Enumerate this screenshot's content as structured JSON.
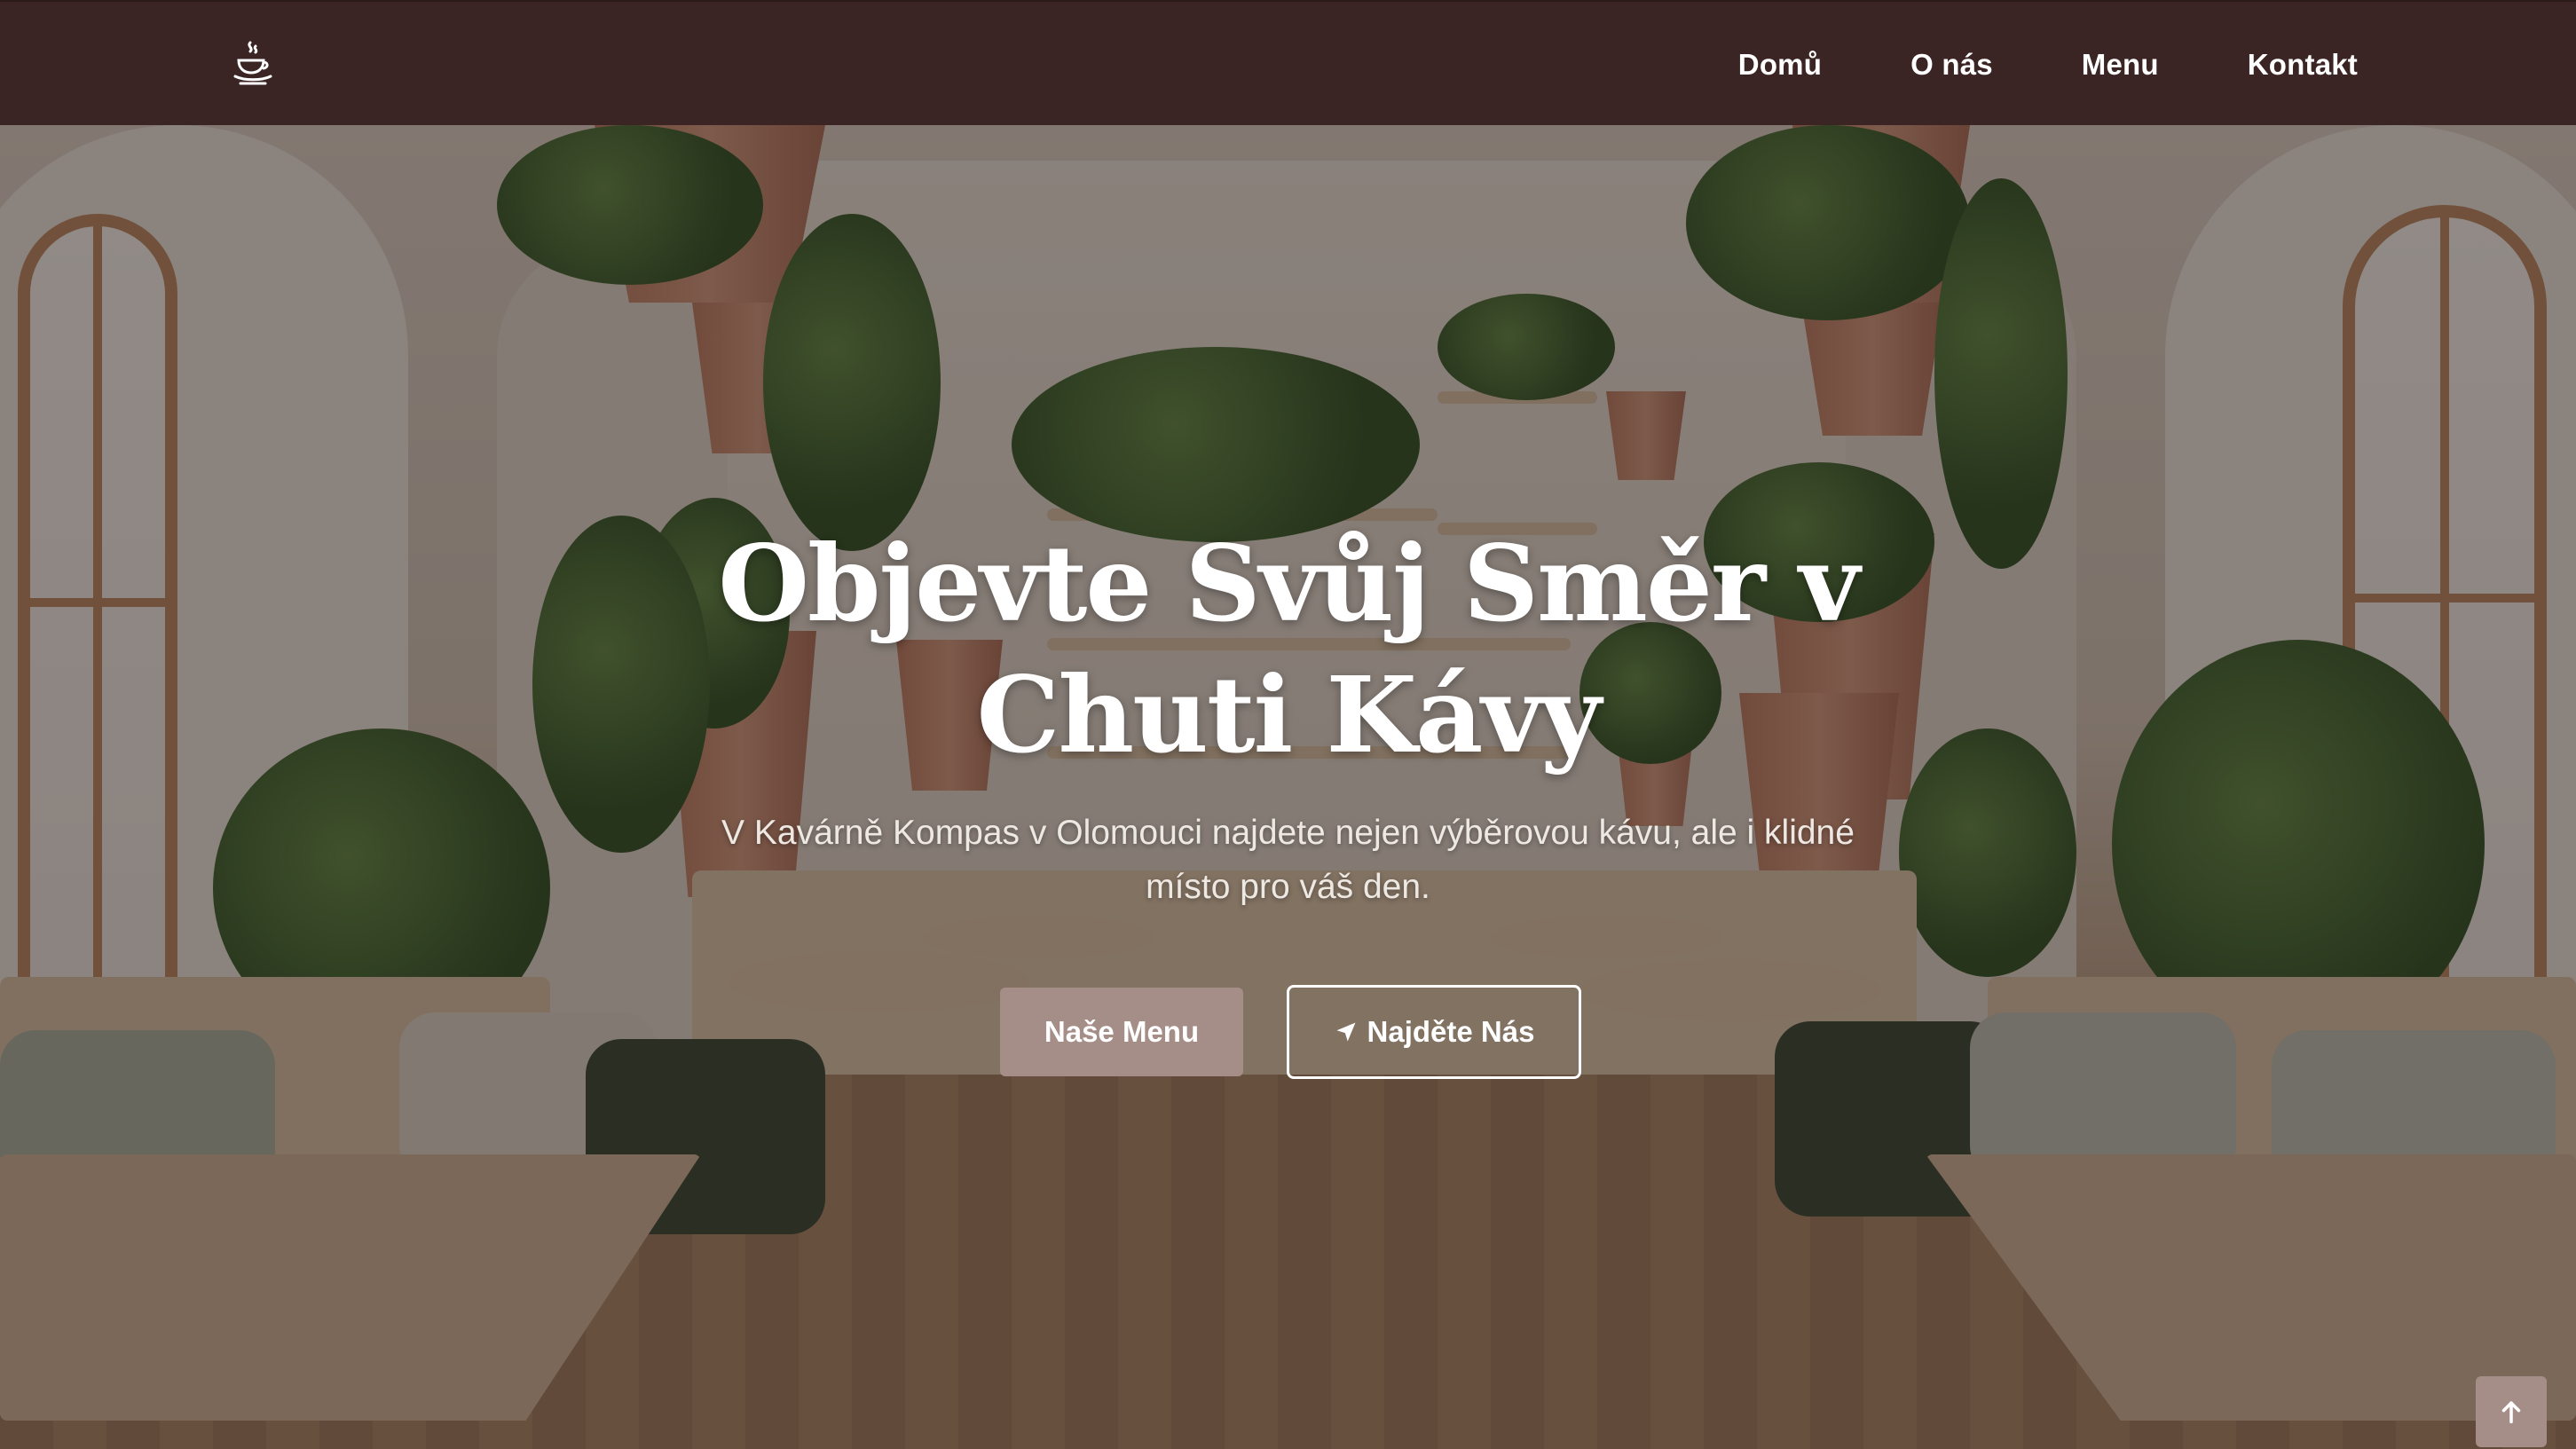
{
  "nav": {
    "logo_icon": "coffee-cup-icon",
    "links": [
      "Domů",
      "O nás",
      "Menu",
      "Kontakt"
    ]
  },
  "hero": {
    "title_line1": "Objevte Svůj Směr v",
    "title_line2": "Chuti Kávy",
    "subtitle_line1": "V Kavárně Kompas v Olomouci najdete nejen výběrovou kávu, ale i klidné",
    "subtitle_line2": "místo pro váš den.",
    "primary_button": "Naše Menu",
    "secondary_button": "Najděte Nás",
    "secondary_button_icon": "location-arrow-icon",
    "background_image": "cafe-interior-with-plants"
  },
  "back_to_top_icon": "arrow-up-icon",
  "colors": {
    "navbar": "#3b2524",
    "accent": "#a68e88",
    "text_light": "#ffffff"
  }
}
